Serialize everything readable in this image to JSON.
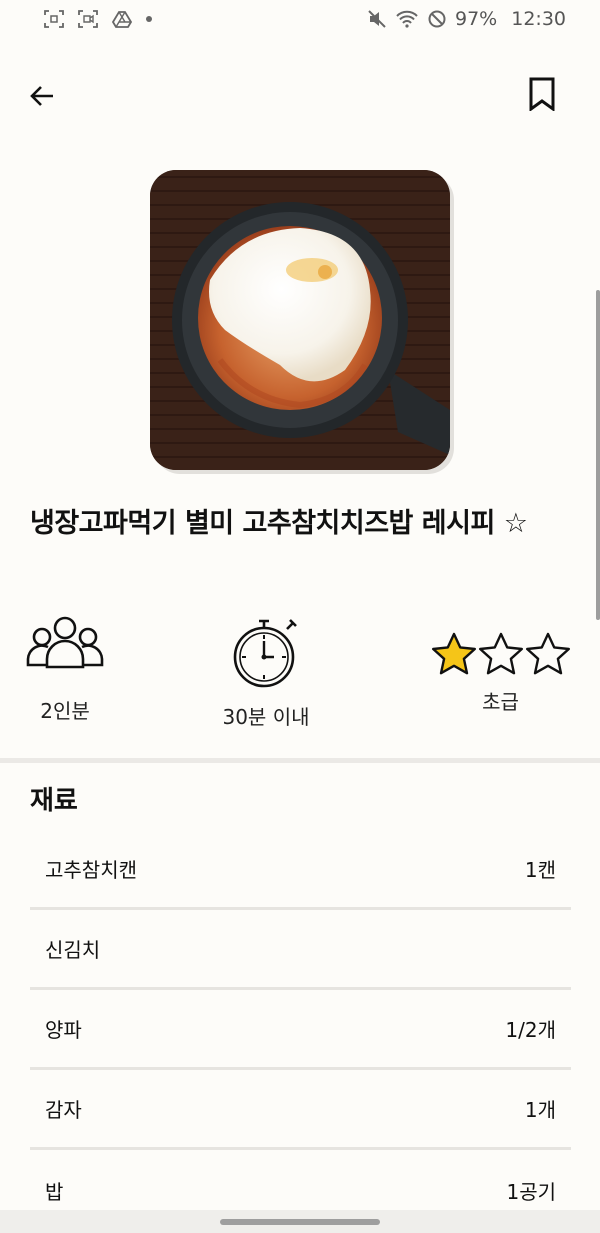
{
  "status_bar": {
    "battery": "97%",
    "time": "12:30"
  },
  "app_bar": {
    "back_icon": "arrow-left-icon",
    "bookmark_icon": "bookmark-icon"
  },
  "recipe": {
    "title": "냉장고파먹기 별미 고추참치치즈밥 레시피 ☆"
  },
  "info": {
    "servings": "2인분",
    "time": "30분 이내",
    "difficulty": "초급",
    "difficulty_stars_filled": 1,
    "difficulty_stars_total": 3,
    "star_color": "#f5c518"
  },
  "ingredients": {
    "title": "재료",
    "items": [
      {
        "name": "고추참치캔",
        "amount": "1캔"
      },
      {
        "name": "신김치",
        "amount": ""
      },
      {
        "name": "양파",
        "amount": "1/2개"
      },
      {
        "name": "감자",
        "amount": "1개"
      },
      {
        "name": "밥",
        "amount": "1공기"
      }
    ]
  }
}
